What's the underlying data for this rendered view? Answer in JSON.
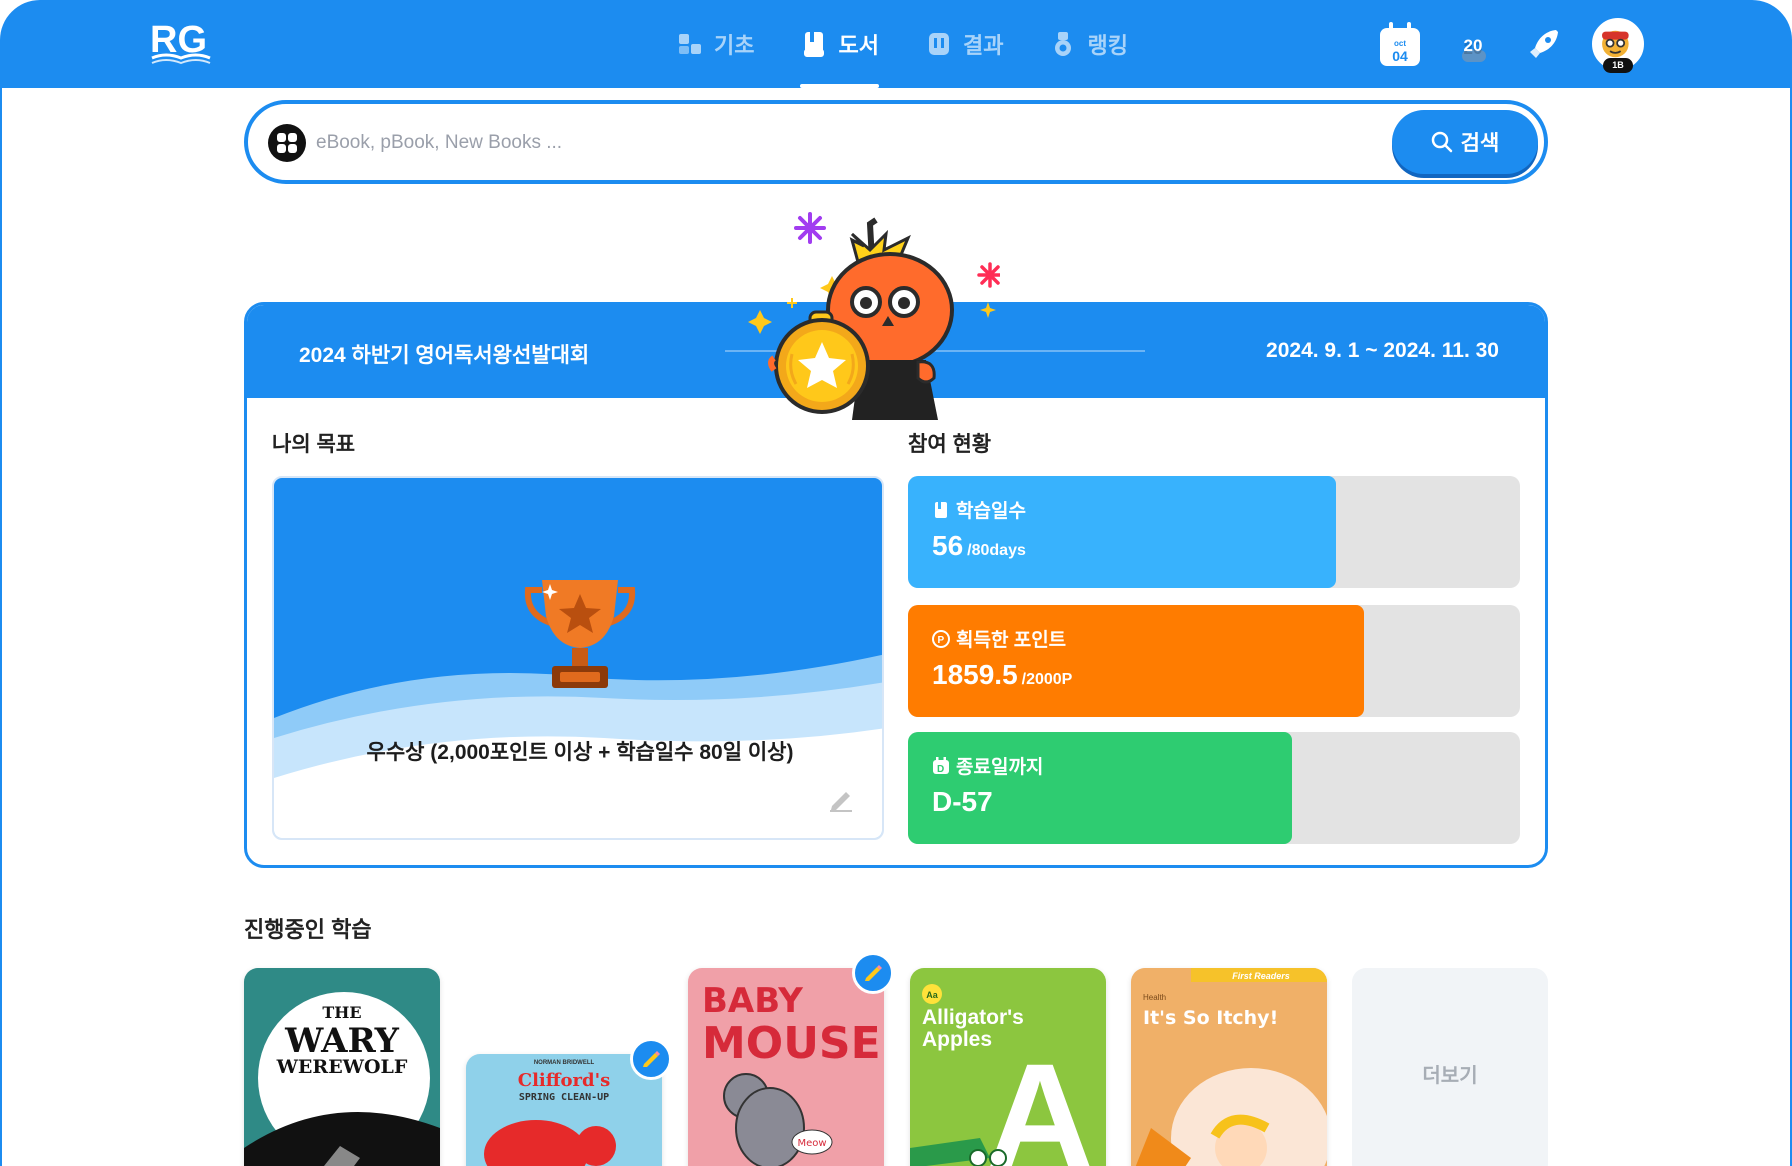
{
  "header": {
    "logo_text": "RG",
    "nav": [
      {
        "label": "기초",
        "icon": "abc-blocks-icon",
        "active": false
      },
      {
        "label": "도서",
        "icon": "book-icon",
        "active": true
      },
      {
        "label": "결과",
        "icon": "result-icon",
        "active": false
      },
      {
        "label": "랭킹",
        "icon": "ranking-icon",
        "active": false
      }
    ],
    "calendar": {
      "month": "oct",
      "day": "04"
    },
    "streak_count": "20",
    "avatar_badge": "1B"
  },
  "search": {
    "placeholder": "eBook, pBook, New Books ...",
    "button_label": "검색"
  },
  "contest": {
    "title": "2024 하반기 영어독서왕선발대회",
    "period": "2024. 9. 1 ~ 2024. 11. 30",
    "goal_label": "나의 목표",
    "goal_text": "우수상 (2,000포인트 이상 + 학습일수 80일 이상)",
    "participation_label": "참여 현황",
    "stats": [
      {
        "label": "학습일수",
        "value": "56",
        "unit": "/80days",
        "progress": 0.7,
        "color": "#38b2fd",
        "icon": "book-icon"
      },
      {
        "label": "획득한 포인트",
        "value": "1859.5",
        "unit": "/2000P",
        "progress": 0.745,
        "color": "#ff7c00",
        "icon": "point-icon"
      },
      {
        "label": "종료일까지",
        "value": "D-57",
        "unit": "",
        "progress": 0.628,
        "color": "#2ecc71",
        "icon": "calendar-d-icon"
      }
    ]
  },
  "learning": {
    "title": "진행중인 학습",
    "books": [
      {
        "title_lines": [
          "THE",
          "WARY",
          "WEREWOLF"
        ],
        "editing": false
      },
      {
        "series": "NORMAN BRIDWELL",
        "title_lines": [
          "Clifford's",
          "SPRING CLEAN-UP"
        ],
        "editing": true
      },
      {
        "title_lines": [
          "BABY",
          "MOUSE"
        ],
        "tag": "Meow",
        "editing": true
      },
      {
        "badge": "Aa",
        "title_lines": [
          "Alligator's",
          "Apples"
        ],
        "letter": "A",
        "editing": false
      },
      {
        "ribbon": "First Readers",
        "category": "Health",
        "title_lines": [
          "It's So Itchy!"
        ],
        "editing": false
      }
    ],
    "more_label": "더보기"
  },
  "colors": {
    "primary": "#1c8cf0",
    "days": "#38b2fd",
    "points": "#ff7c00",
    "dday": "#2ecc71"
  }
}
